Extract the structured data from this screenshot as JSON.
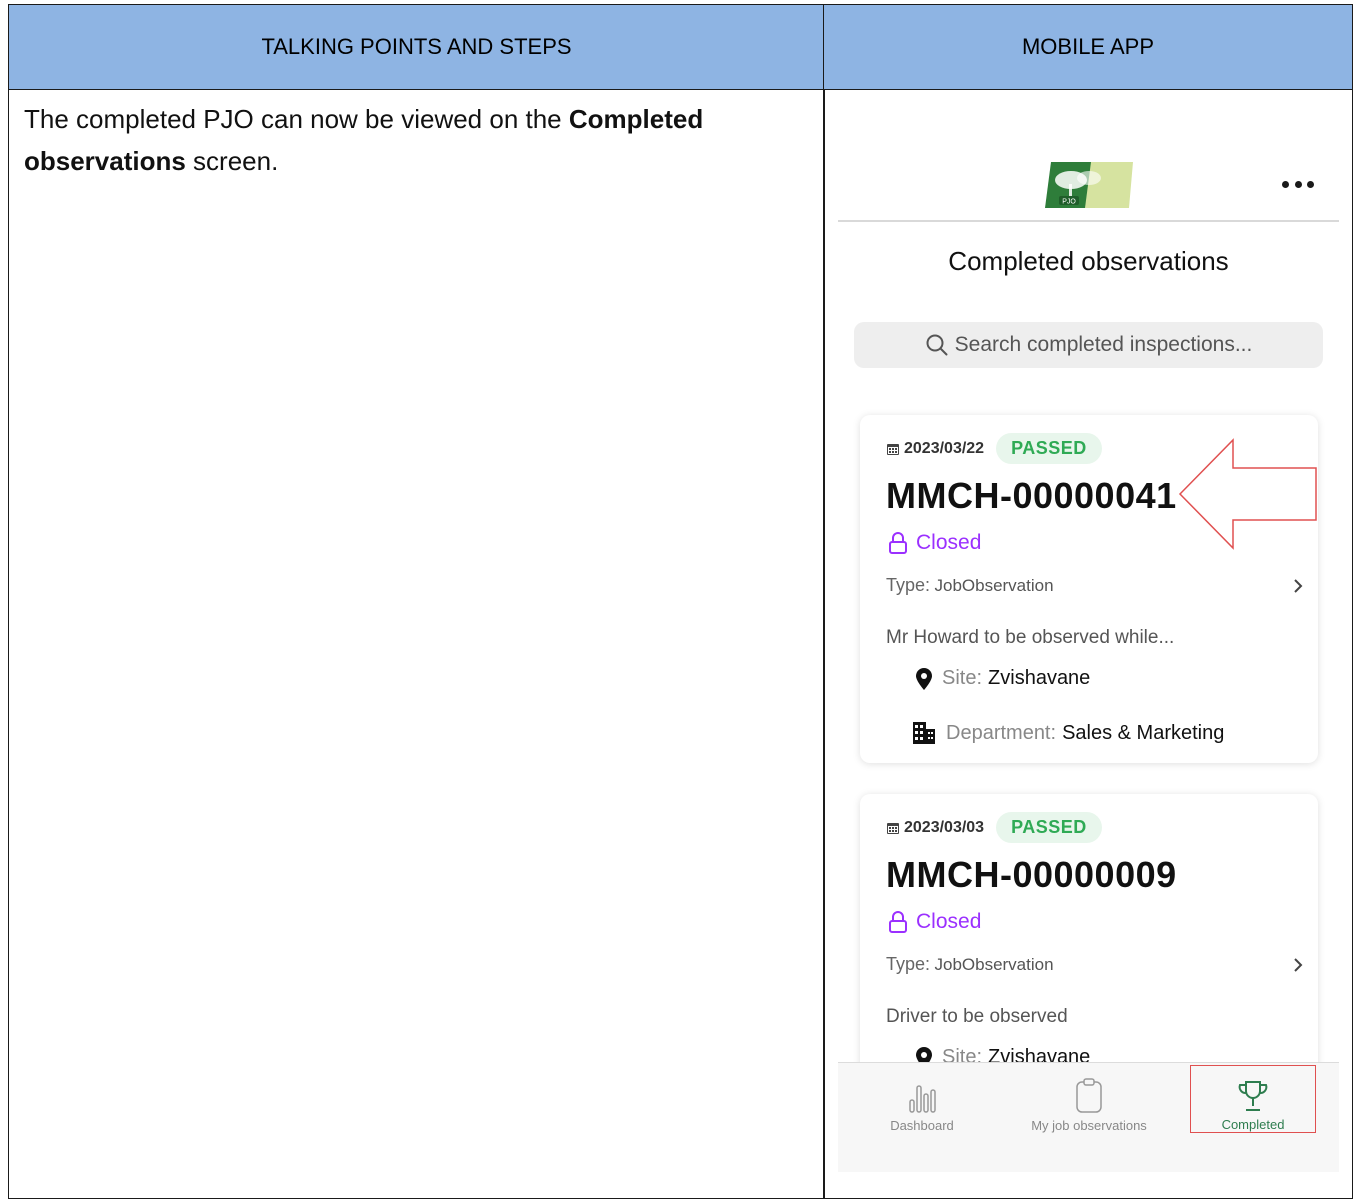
{
  "doc": {
    "header_left": "TALKING POINTS AND STEPS",
    "header_right": "MOBILE APP",
    "talk": {
      "pre": "The completed PJO can now be viewed on the ",
      "bold": "Completed observations",
      "post": " screen."
    }
  },
  "app": {
    "logo_text": "PJO",
    "screen_title": "Completed observations",
    "search_placeholder": "Search completed inspections...",
    "cards": [
      {
        "date": "2023/03/22",
        "status": "PASSED",
        "code": "MMCH-00000041",
        "closed": "Closed",
        "type_label": "Type:",
        "type_value": "JobObservation",
        "description": "Mr Howard to be observed while...",
        "site_label": "Site:",
        "site_value": "Zvishavane",
        "dept_label": "Department:",
        "dept_value": "Sales & Marketing"
      },
      {
        "date": "2023/03/03",
        "status": "PASSED",
        "code": "MMCH-00000009",
        "closed": "Closed",
        "type_label": "Type:",
        "type_value": "JobObservation",
        "description": "Driver to be observed",
        "site_label": "Site:",
        "site_value": "Zvishavane"
      }
    ],
    "tabs": [
      {
        "label": "Dashboard",
        "icon": "bar-chart-icon"
      },
      {
        "label": "My job observations",
        "icon": "clipboard-icon"
      },
      {
        "label": "Completed",
        "icon": "trophy-icon",
        "active": true
      }
    ],
    "colors": {
      "header_blue": "#8eb4e3",
      "passed_green": "#2faa55",
      "closed_purple": "#9b30ff",
      "active_tab_green": "#2e7d4f",
      "highlight_red": "#e05050"
    }
  }
}
